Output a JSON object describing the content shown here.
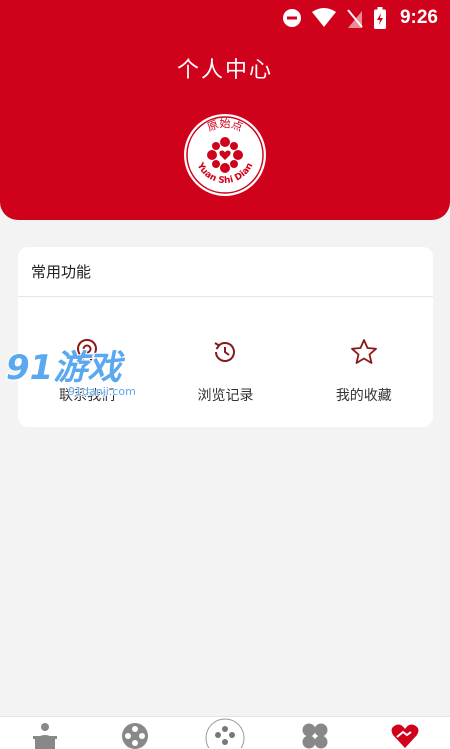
{
  "status_bar": {
    "time": "9:26"
  },
  "header": {
    "title": "个人中心",
    "logo_text_top": "原始点",
    "logo_text_bottom": "Yuan Shi Dian"
  },
  "section": {
    "title": "常用功能",
    "items": [
      {
        "label": "联系我们",
        "icon": "location-pin-icon"
      },
      {
        "label": "浏览记录",
        "icon": "history-icon"
      },
      {
        "label": "我的收藏",
        "icon": "star-icon"
      }
    ]
  },
  "watermark": {
    "main": "91游戏",
    "sub": "91danji.com"
  },
  "tabbar": {
    "tabs": [
      {
        "icon": "figure-icon"
      },
      {
        "icon": "circles-icon"
      },
      {
        "icon": "logo-icon"
      },
      {
        "icon": "grid-icon"
      },
      {
        "icon": "heart-hands-icon",
        "active": true
      }
    ]
  },
  "colors": {
    "brand": "#d0021b",
    "background": "#f3f3f3",
    "icon_dark": "#8a1a1a"
  }
}
